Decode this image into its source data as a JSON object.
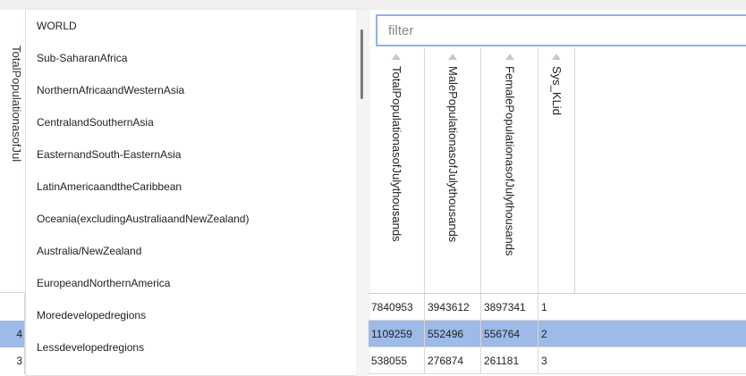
{
  "left_panel": {
    "vertical_fragment": "TotalPopulationasofJuly",
    "row_fragments": [
      "",
      "4",
      "3"
    ]
  },
  "dropdown": {
    "items": [
      "WORLD",
      "Sub-SaharanAfrica",
      "NorthernAfricaandWesternAsia",
      "CentralandSouthernAsia",
      "EasternandSouth-EasternAsia",
      "LatinAmericaandtheCaribbean",
      "Oceania(excludingAustraliaandNewZealand)",
      "Australia/NewZealand",
      "EuropeandNorthernAmerica",
      "Moredevelopedregions",
      "Lessdevelopedregions"
    ]
  },
  "filter": {
    "placeholder": "filter",
    "value": ""
  },
  "table": {
    "columns": [
      "TotalPopulationasofJulythousands",
      "MalePopulationasofJulythousands",
      "FemalePopulationasofJulythousands",
      "Sys_KLid"
    ],
    "rows": [
      [
        "7840953",
        "3943612",
        "3897341",
        "1"
      ],
      [
        "1109259",
        "552496",
        "556764",
        "2"
      ],
      [
        "538055",
        "276874",
        "261181",
        "3"
      ]
    ],
    "selected_row_index": 1
  },
  "colors": {
    "selection": "#9dbae8",
    "focus_border": "#8fb2e6"
  }
}
